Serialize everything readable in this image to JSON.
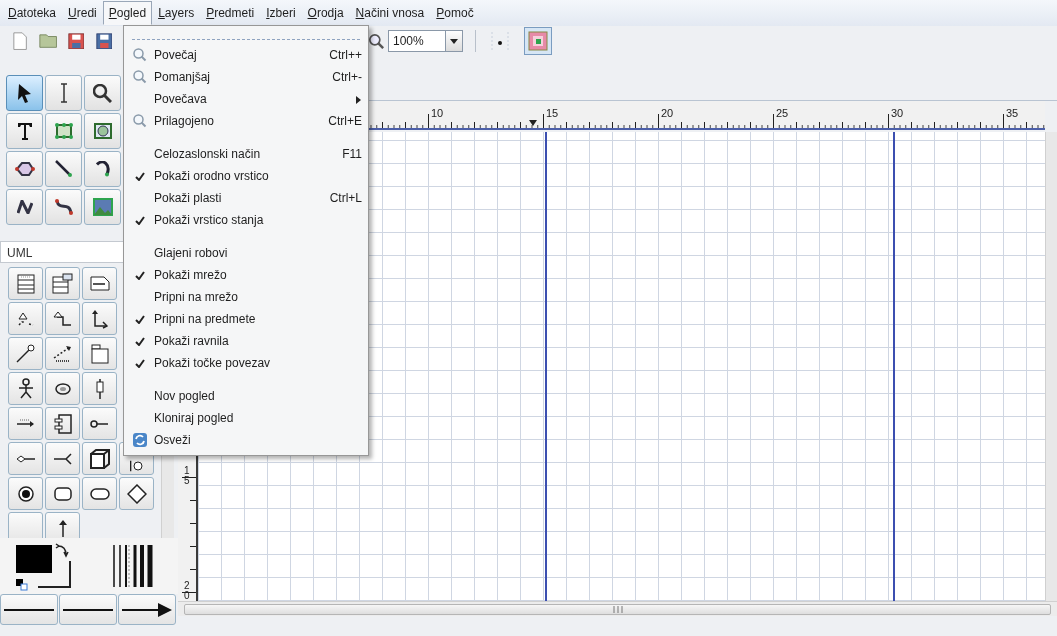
{
  "menubar": [
    {
      "label": "Datoteka",
      "selected": false
    },
    {
      "label": "Uredi",
      "selected": false
    },
    {
      "label": "Pogled",
      "selected": true
    },
    {
      "label": "Layers",
      "selected": false
    },
    {
      "label": "Predmeti",
      "selected": false
    },
    {
      "label": "Izberi",
      "selected": false
    },
    {
      "label": "Orodja",
      "selected": false
    },
    {
      "label": "Načini vnosa",
      "selected": false
    },
    {
      "label": "Pomoč",
      "selected": false
    }
  ],
  "toolbar": {
    "zoom": "100%"
  },
  "tools": [
    {
      "selected": true
    },
    {
      "selected": false
    },
    {
      "selected": false
    },
    {
      "selected": false
    },
    {
      "selected": false
    },
    {
      "selected": false
    },
    {
      "selected": false
    },
    {
      "selected": false
    },
    {
      "selected": false
    },
    {
      "selected": false
    },
    {
      "selected": false
    },
    {
      "selected": false
    }
  ],
  "sheet": {
    "name": "UML"
  },
  "menu": {
    "items": [
      {
        "kind": "zoom",
        "label": "Povečaj",
        "shortcut": "Ctrl++",
        "checked": false
      },
      {
        "kind": "zoom",
        "label": "Pomanjšaj",
        "shortcut": "Ctrl+-",
        "checked": false
      },
      {
        "kind": "submenu",
        "label": "Povečava",
        "checked": false
      },
      {
        "kind": "zoom",
        "label": "Prilagojeno",
        "shortcut": "Ctrl+E",
        "checked": false
      },
      {
        "kind": "separator"
      },
      {
        "kind": "item",
        "label": "Celozaslonski način",
        "shortcut": "F11",
        "checked": false
      },
      {
        "kind": "item",
        "label": "Pokaži orodno vrstico",
        "checked": true
      },
      {
        "kind": "item",
        "label": "Pokaži plasti",
        "shortcut": "Ctrl+L",
        "checked": false
      },
      {
        "kind": "item",
        "label": "Pokaži vrstico stanja",
        "checked": true
      },
      {
        "kind": "separator"
      },
      {
        "kind": "item",
        "label": "Glajeni robovi",
        "checked": false
      },
      {
        "kind": "item",
        "label": "Pokaži mrežo",
        "checked": true
      },
      {
        "kind": "item",
        "label": "Pripni na mrežo",
        "checked": false
      },
      {
        "kind": "item",
        "label": "Pripni na predmete",
        "checked": true
      },
      {
        "kind": "item",
        "label": "Pokaži ravnila",
        "checked": true
      },
      {
        "kind": "item",
        "label": "Pokaži točke povezav",
        "checked": true
      },
      {
        "kind": "separator"
      },
      {
        "kind": "item",
        "label": "Nov pogled",
        "checked": false
      },
      {
        "kind": "item",
        "label": "Kloniraj pogled",
        "checked": false
      },
      {
        "kind": "refresh",
        "label": "Osveži",
        "checked": false
      }
    ]
  },
  "rulers": {
    "horizontal": [
      "10",
      "15",
      "20",
      "25",
      "30",
      "35"
    ],
    "vertical": [
      "15",
      "20"
    ]
  }
}
